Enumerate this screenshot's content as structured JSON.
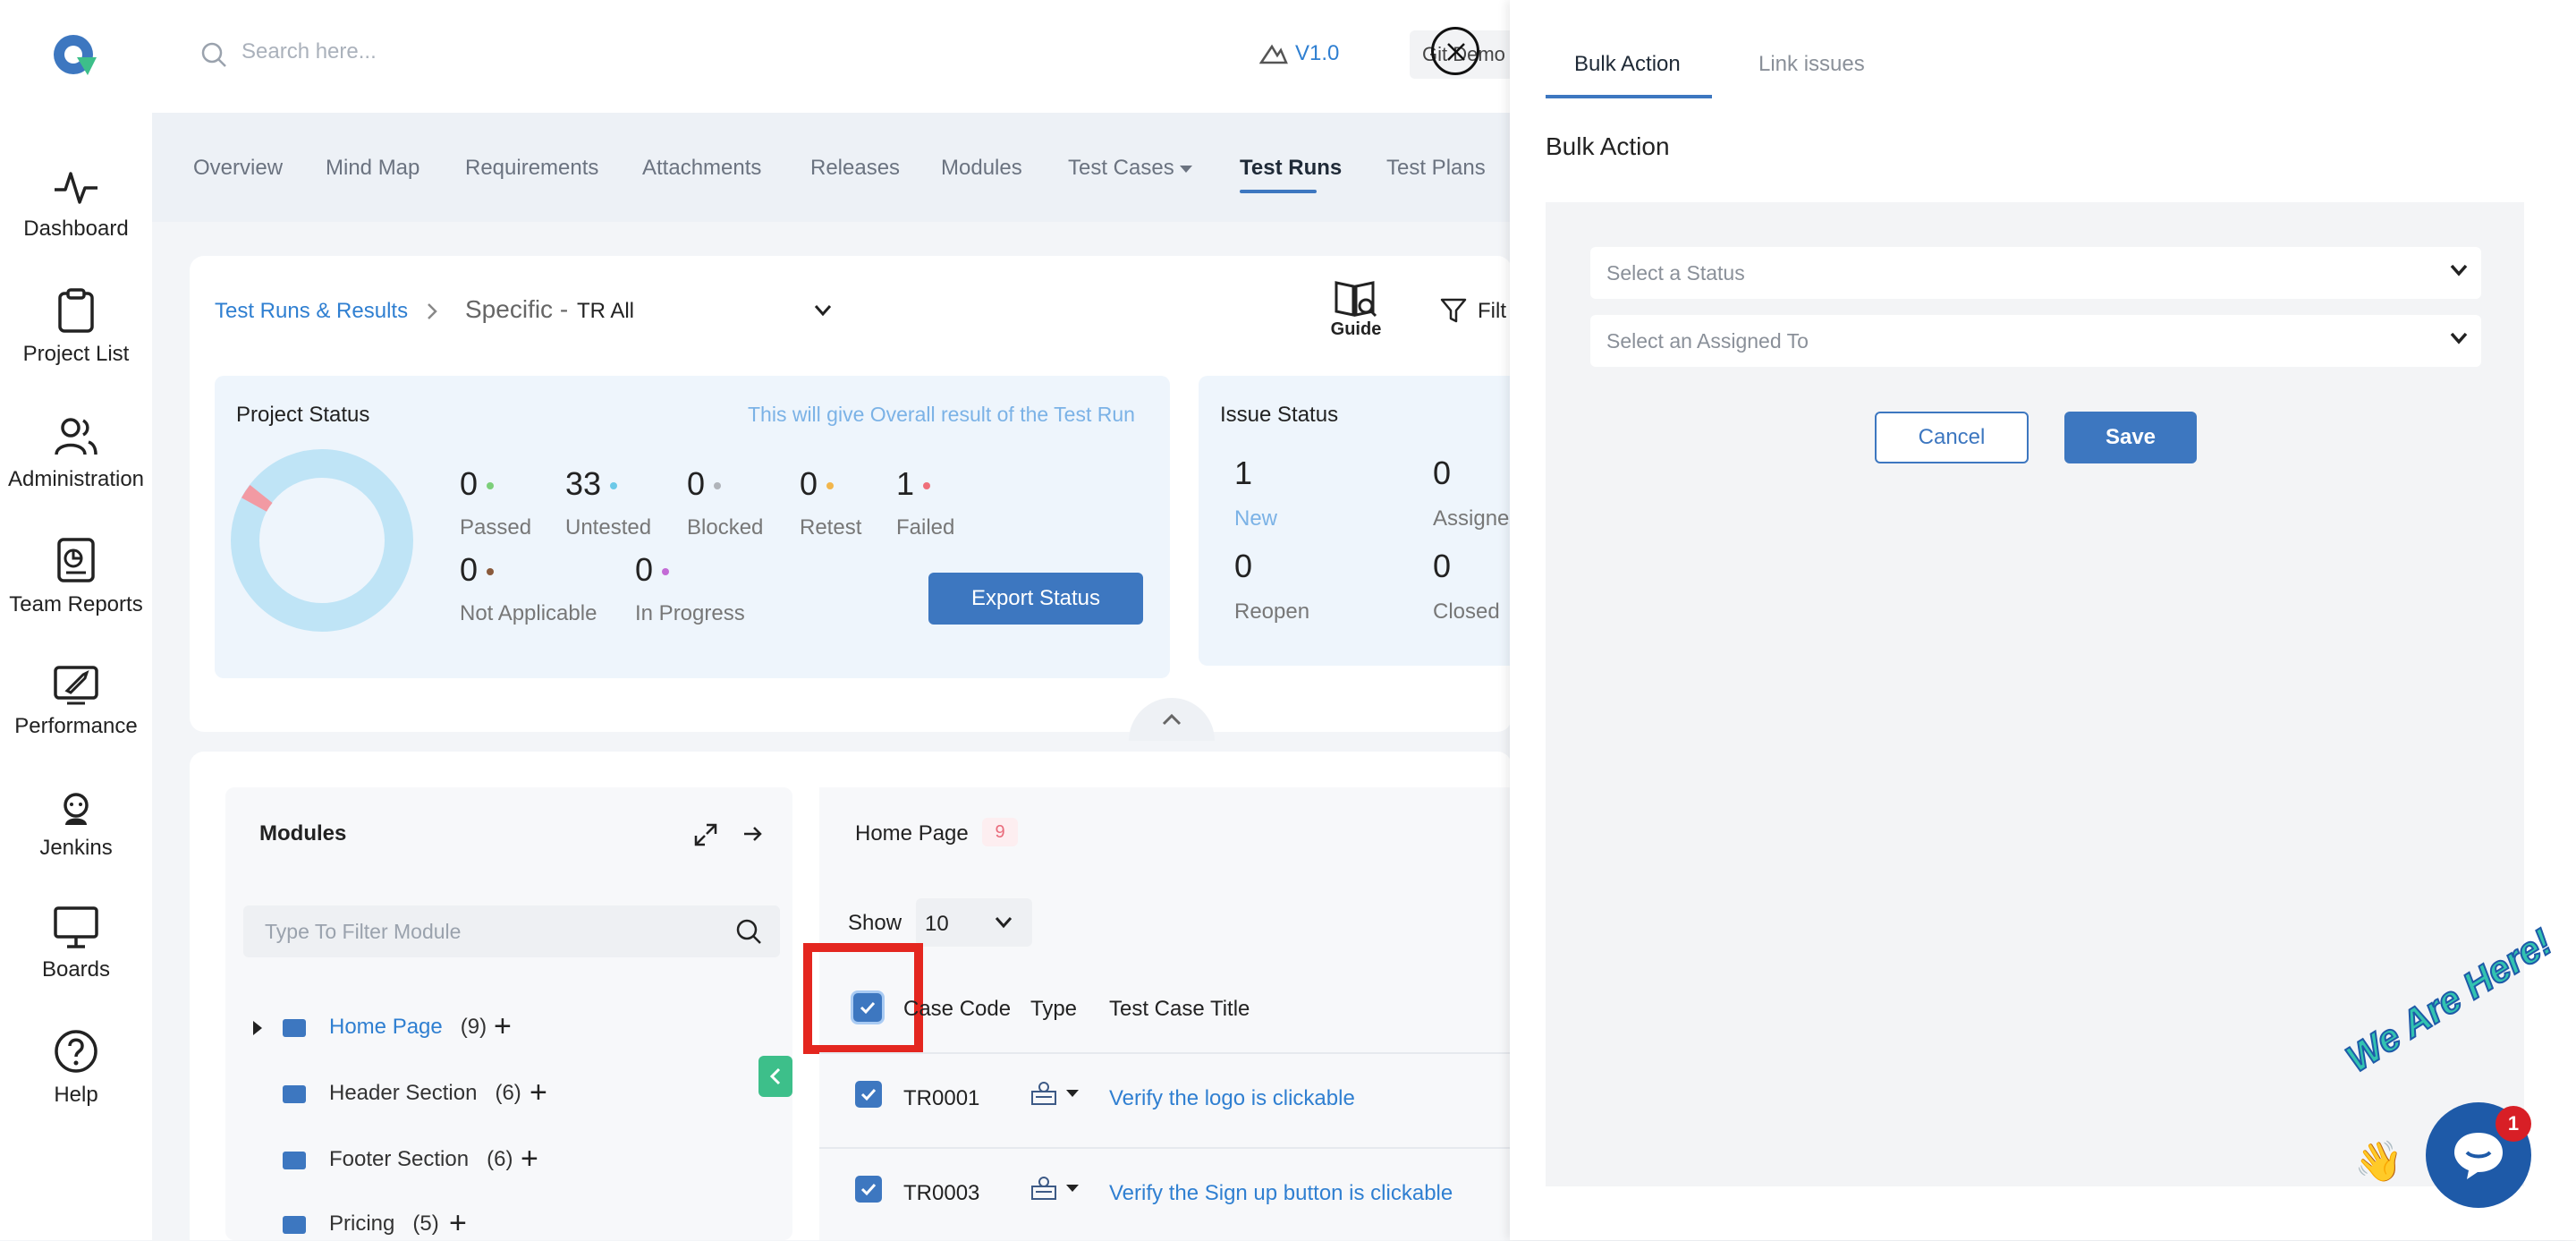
{
  "sidebar": {
    "items": [
      {
        "label": "Dashboard",
        "icon": "pulse-icon"
      },
      {
        "label": "Project List",
        "icon": "clipboard-icon"
      },
      {
        "label": "Administration",
        "icon": "users-icon"
      },
      {
        "label": "Team Reports",
        "icon": "report-icon"
      },
      {
        "label": "Performance",
        "icon": "rocket-icon"
      },
      {
        "label": "Jenkins",
        "icon": "jenkins-icon"
      },
      {
        "label": "Boards",
        "icon": "monitor-icon"
      },
      {
        "label": "Help",
        "icon": "help-icon"
      }
    ]
  },
  "header": {
    "search_placeholder": "Search here...",
    "version": "V1.0",
    "project_chip": "Git Demo"
  },
  "nav": {
    "tabs": [
      "Overview",
      "Mind Map",
      "Requirements",
      "Attachments",
      "Releases",
      "Modules",
      "Test Cases",
      "Test Runs",
      "Test Plans"
    ],
    "active": "Test Runs"
  },
  "breadcrumb": {
    "root": "Test Runs & Results",
    "specific": "Specific -",
    "value": "TR All",
    "guide": "Guide",
    "filter": "Filt"
  },
  "project_status": {
    "title": "Project Status",
    "hint": "This will give Overall result of the Test Run",
    "stats": [
      {
        "value": "0",
        "label": "Passed",
        "color": "#7ccf7a"
      },
      {
        "value": "33",
        "label": "Untested",
        "color": "#6cc9e8"
      },
      {
        "value": "0",
        "label": "Blocked",
        "color": "#b0b4ba"
      },
      {
        "value": "0",
        "label": "Retest",
        "color": "#f2b64c"
      },
      {
        "value": "1",
        "label": "Failed",
        "color": "#ef6f7a"
      },
      {
        "value": "0",
        "label": "Not Applicable",
        "color": "#8a5a3c"
      },
      {
        "value": "0",
        "label": "In Progress",
        "color": "#c36bd6"
      }
    ],
    "export_label": "Export Status"
  },
  "issue_status": {
    "title": "Issue Status",
    "stats": [
      {
        "value": "1",
        "label": "New"
      },
      {
        "value": "0",
        "label": "Assigne"
      },
      {
        "value": "0",
        "label": "Reopen"
      },
      {
        "value": "0",
        "label": "Closed"
      }
    ]
  },
  "modules": {
    "title": "Modules",
    "filter_placeholder": "Type To Filter Module",
    "items": [
      {
        "name": "Home Page",
        "count": "(9)"
      },
      {
        "name": "Header Section",
        "count": "(6)"
      },
      {
        "name": "Footer Section",
        "count": "(6)"
      },
      {
        "name": "Pricing",
        "count": "(5)"
      }
    ]
  },
  "testcases": {
    "title": "Home Page",
    "count": "9",
    "show_label": "Show",
    "show_value": "10",
    "columns": [
      "Case Code",
      "Type",
      "Test Case Title"
    ],
    "rows": [
      {
        "code": "TR0001",
        "title": "Verify the logo is clickable"
      },
      {
        "code": "TR0003",
        "title": "Verify the Sign up button is clickable"
      }
    ]
  },
  "panel": {
    "tabs": [
      "Bulk Action",
      "Link issues"
    ],
    "title": "Bulk Action",
    "status_placeholder": "Select a Status",
    "assigned_placeholder": "Select an Assigned To",
    "cancel_label": "Cancel",
    "save_label": "Save"
  },
  "chat": {
    "badge": "1",
    "tagline": "We Are Here!"
  },
  "colors": {
    "accent": "#3d77c0",
    "link": "#2f7fd1",
    "highlight": "#e4261f"
  }
}
